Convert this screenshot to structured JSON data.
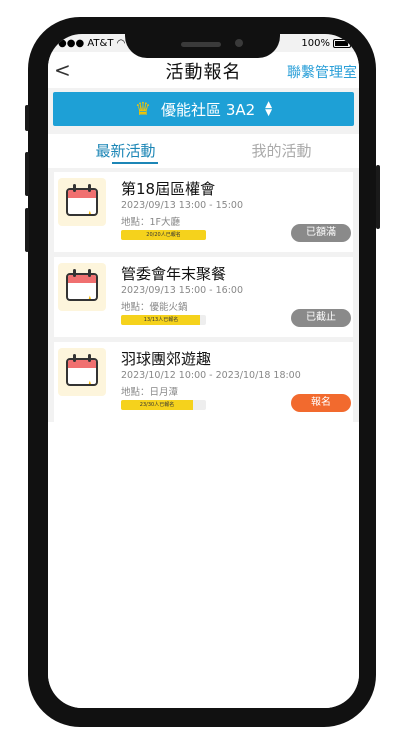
{
  "status_bar": {
    "carrier": "AT&T",
    "battery": "100%"
  },
  "header": {
    "title": "活動報名",
    "right_link": "聯繫管理室"
  },
  "community": {
    "name": "優能社區 3A2"
  },
  "tabs": [
    {
      "label": "最新活動"
    },
    {
      "label": "我的活動"
    }
  ],
  "events": [
    {
      "title": "第18屆區權會",
      "time": "2023/09/13 13:00 - 15:00",
      "location": "地點：1F大廳",
      "capacity": "20/20人已報名",
      "fill_ratio": 1.0,
      "button": "已額滿"
    },
    {
      "title": "管委會年末聚餐",
      "time": "2023/09/13 15:00 - 16:00",
      "location": "地點：優能火鍋",
      "capacity": "13/13人已報名",
      "fill_ratio": 0.93,
      "button": "已截止"
    },
    {
      "title": "羽球團郊遊趣",
      "time": "2023/10/12 10:00 - 2023/10/18 18:00",
      "location": "地點：日月潭",
      "capacity": "23/30人已報名",
      "fill_ratio": 0.85,
      "button": "報名"
    }
  ]
}
